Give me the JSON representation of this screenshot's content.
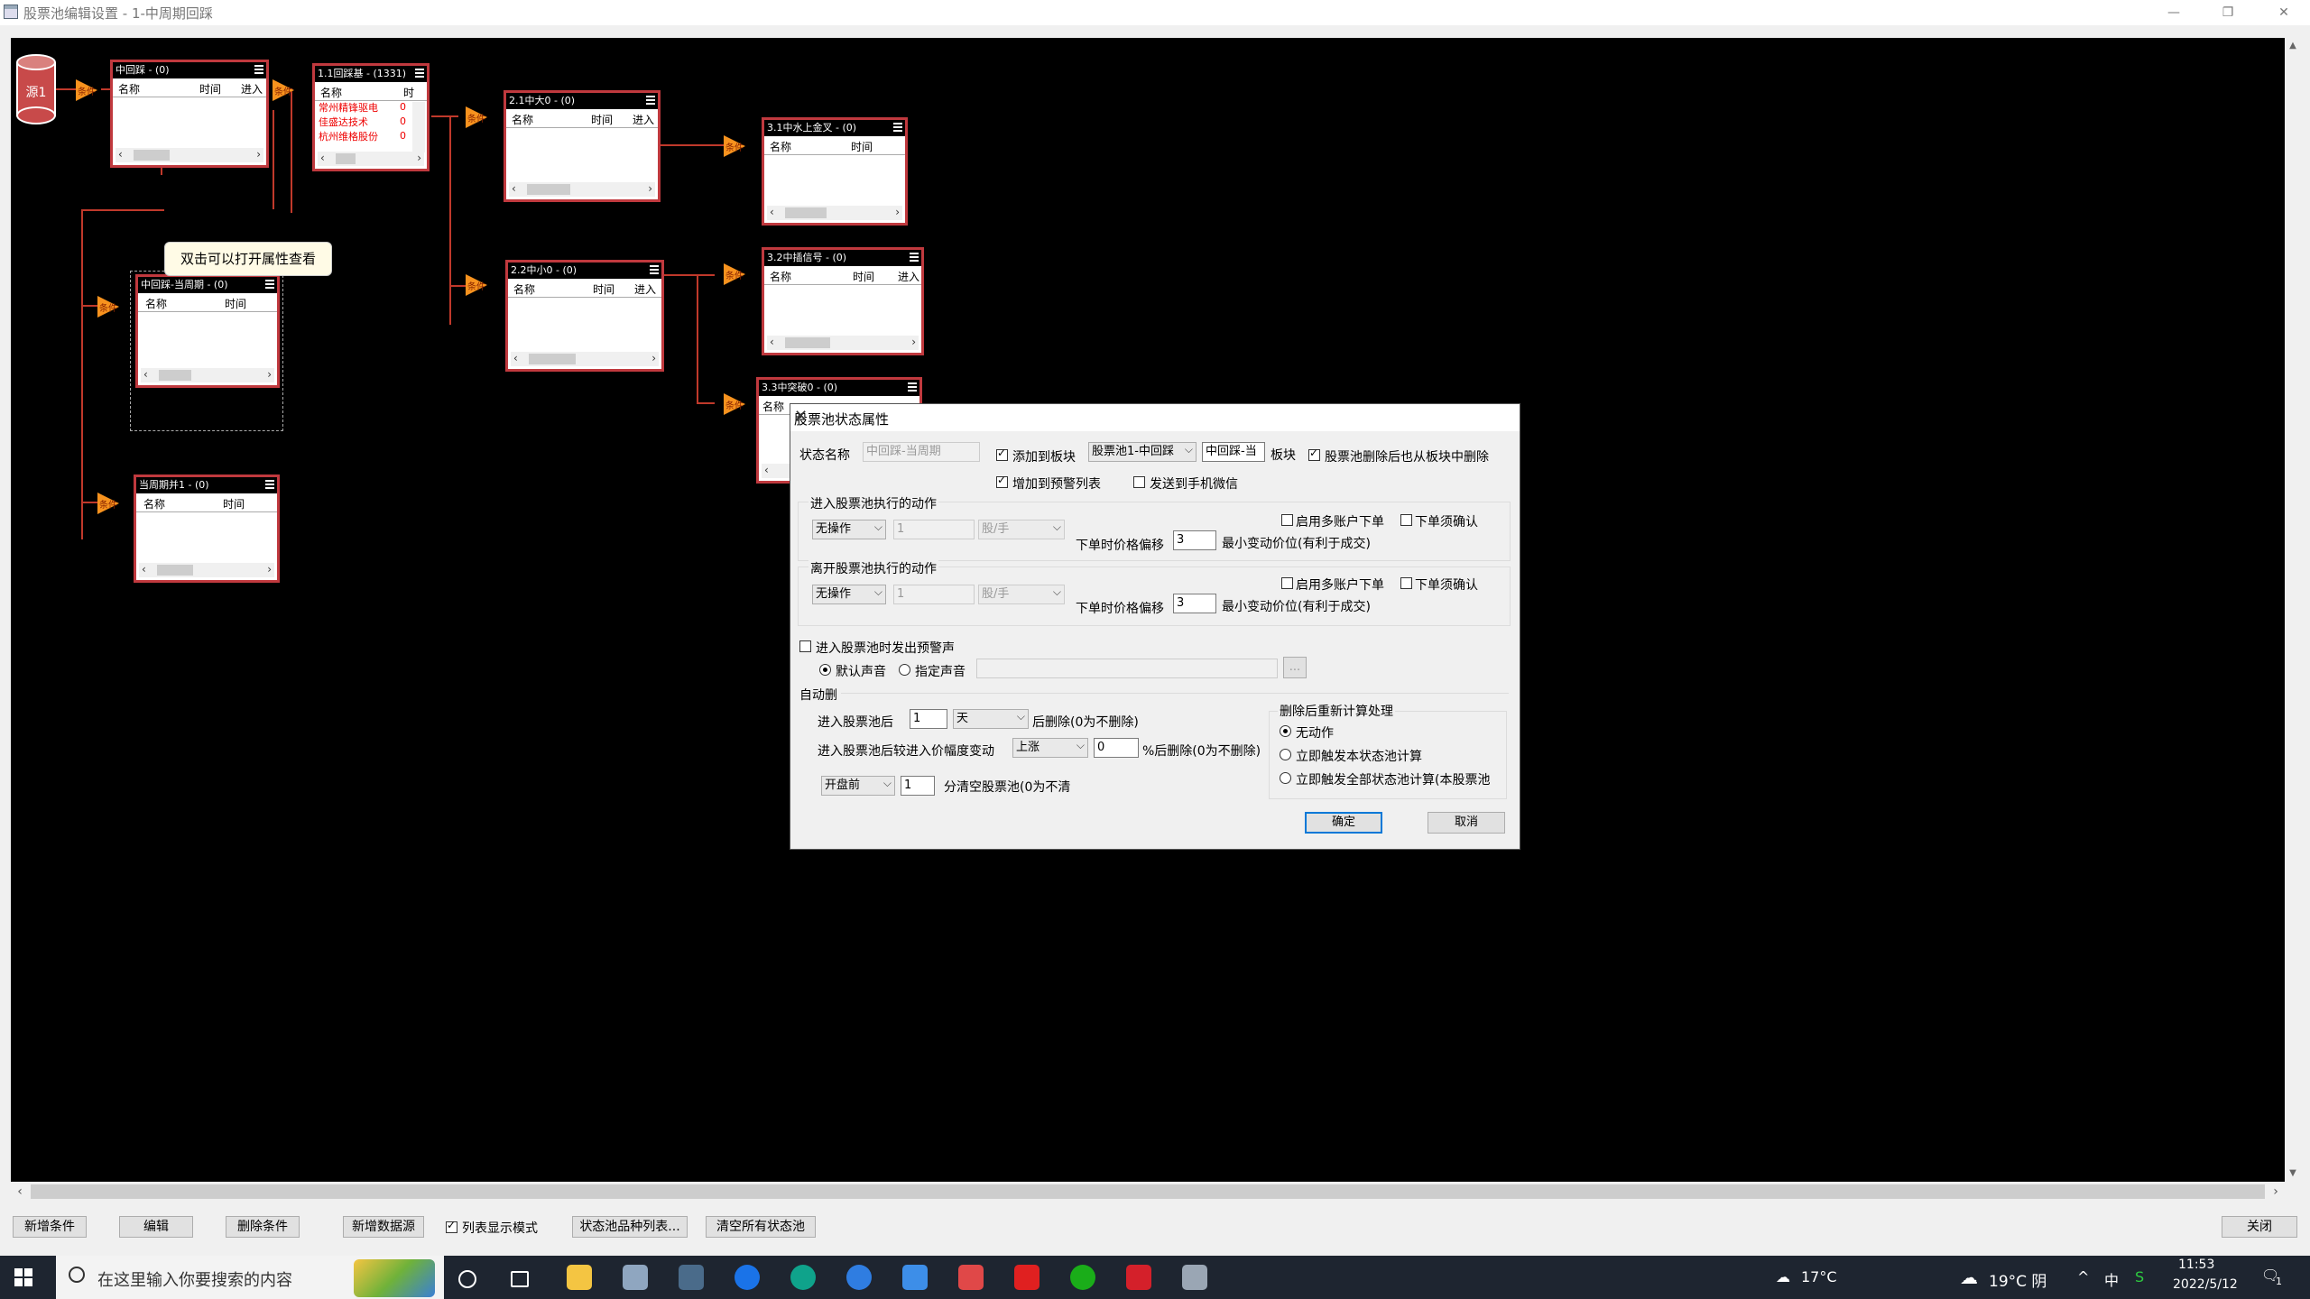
{
  "window": {
    "title": "股票池编辑设置 - 1-中周期回踩",
    "minimize": "—",
    "restore": "❐",
    "close": "✕"
  },
  "canvas": {
    "source_label": "源1",
    "tooltip": "双击可以打开属性查看",
    "nodes": [
      {
        "title": "中回踩 - (0)",
        "cols": [
          "名称",
          "时间",
          "进入"
        ],
        "rows": []
      },
      {
        "title": "1.1回踩基 - (1331)",
        "cols": [
          "名称",
          "时"
        ],
        "rows": [
          "常州精锋驱电",
          "佳盛达技术",
          "杭州维格股份"
        ],
        "row_values": [
          "0",
          "0",
          "0"
        ]
      },
      {
        "title": "2.1中大0 - (0)",
        "cols": [
          "名称",
          "时间",
          "进入"
        ],
        "rows": []
      },
      {
        "title": "3.1中水上金叉 - (0)",
        "cols": [
          "名称",
          "时间"
        ],
        "rows": []
      },
      {
        "title": "中回踩-当周期 - (0)",
        "cols": [
          "名称",
          "时间"
        ],
        "rows": []
      },
      {
        "title": "2.2中小0 - (0)",
        "cols": [
          "名称",
          "时间",
          "进入"
        ],
        "rows": []
      },
      {
        "title": "3.2中插信号 - (0)",
        "cols": [
          "名称",
          "时间",
          "进入"
        ],
        "rows": []
      },
      {
        "title": "3.3中突破0 - (0)",
        "cols": [
          "名称"
        ],
        "rows": []
      },
      {
        "title": "当周期并1 - (0)",
        "cols": [
          "名称",
          "时间"
        ],
        "rows": []
      }
    ],
    "triangle_label": "条件"
  },
  "dialog": {
    "title": "股票池状态属性",
    "state_name_label": "状态名称",
    "state_name_value": "中回踩-当周期",
    "add_to_block_label": "添加到板块",
    "add_to_block_checked": true,
    "block_select_value": "股票池1-中回踩",
    "block_name_value": "中回踩-当",
    "block_suffix": "板块",
    "delete_from_block_label": "股票池删除后也从板块中删除",
    "delete_from_block_checked": true,
    "add_to_warning_label": "增加到预警列表",
    "add_to_warning_checked": true,
    "send_wechat_label": "发送到手机微信",
    "send_wechat_checked": false,
    "enter_section": {
      "title": "进入股票池执行的动作",
      "action": "无操作",
      "qty": "1",
      "unit": "股/手",
      "multi_account_label": "启用多账户下单",
      "confirm_label": "下单须确认",
      "offset_label": "下单时价格偏移",
      "offset_value": "3",
      "offset_suffix": "最小变动价位(有利于成交)"
    },
    "leave_section": {
      "title": "离开股票池执行的动作",
      "action": "无操作",
      "qty": "1",
      "unit": "股/手",
      "multi_account_label": "启用多账户下单",
      "confirm_label": "下单须确认",
      "offset_label": "下单时价格偏移",
      "offset_value": "3",
      "offset_suffix": "最小变动价位(有利于成交)"
    },
    "alarm_label": "进入股票池时发出预警声",
    "default_sound_label": "默认声音",
    "custom_sound_label": "指定声音",
    "browse_label": "...",
    "auto_delete": {
      "title": "自动删",
      "after_enter_label": "进入股票池后",
      "after_enter_value": "1",
      "after_enter_unit": "天",
      "after_enter_suffix": "后删除(0为不删除)",
      "price_change_label": "进入股票池后较进入价幅度变动",
      "price_direction": "上涨",
      "price_value": "0",
      "price_suffix": "%后删除(0为不删除)",
      "clear_time": "开盘前",
      "clear_value": "1",
      "clear_suffix": "分清空股票池(0为不清"
    },
    "recalc": {
      "title": "删除后重新计算处理",
      "options": [
        "无动作",
        "立即触发本状态池计算",
        "立即触发全部状态池计算(本股票池"
      ],
      "selected": 0
    },
    "ok_label": "确定",
    "cancel_label": "取消"
  },
  "toolbar": {
    "buttons": [
      "新增条件",
      "编辑",
      "删除条件",
      "新增数据源",
      "状态池品种列表...",
      "清空所有状态池"
    ],
    "list_mode_label": "列表显示模式",
    "list_mode_checked": true,
    "close_label": "关闭"
  },
  "taskbar": {
    "search_placeholder": "在这里输入你要搜索的内容",
    "weather_left": "17°C",
    "weather_right": "19°C 阴",
    "ime": "中",
    "time": "11:53",
    "date": "2022/5/12",
    "notification_count": "1"
  }
}
